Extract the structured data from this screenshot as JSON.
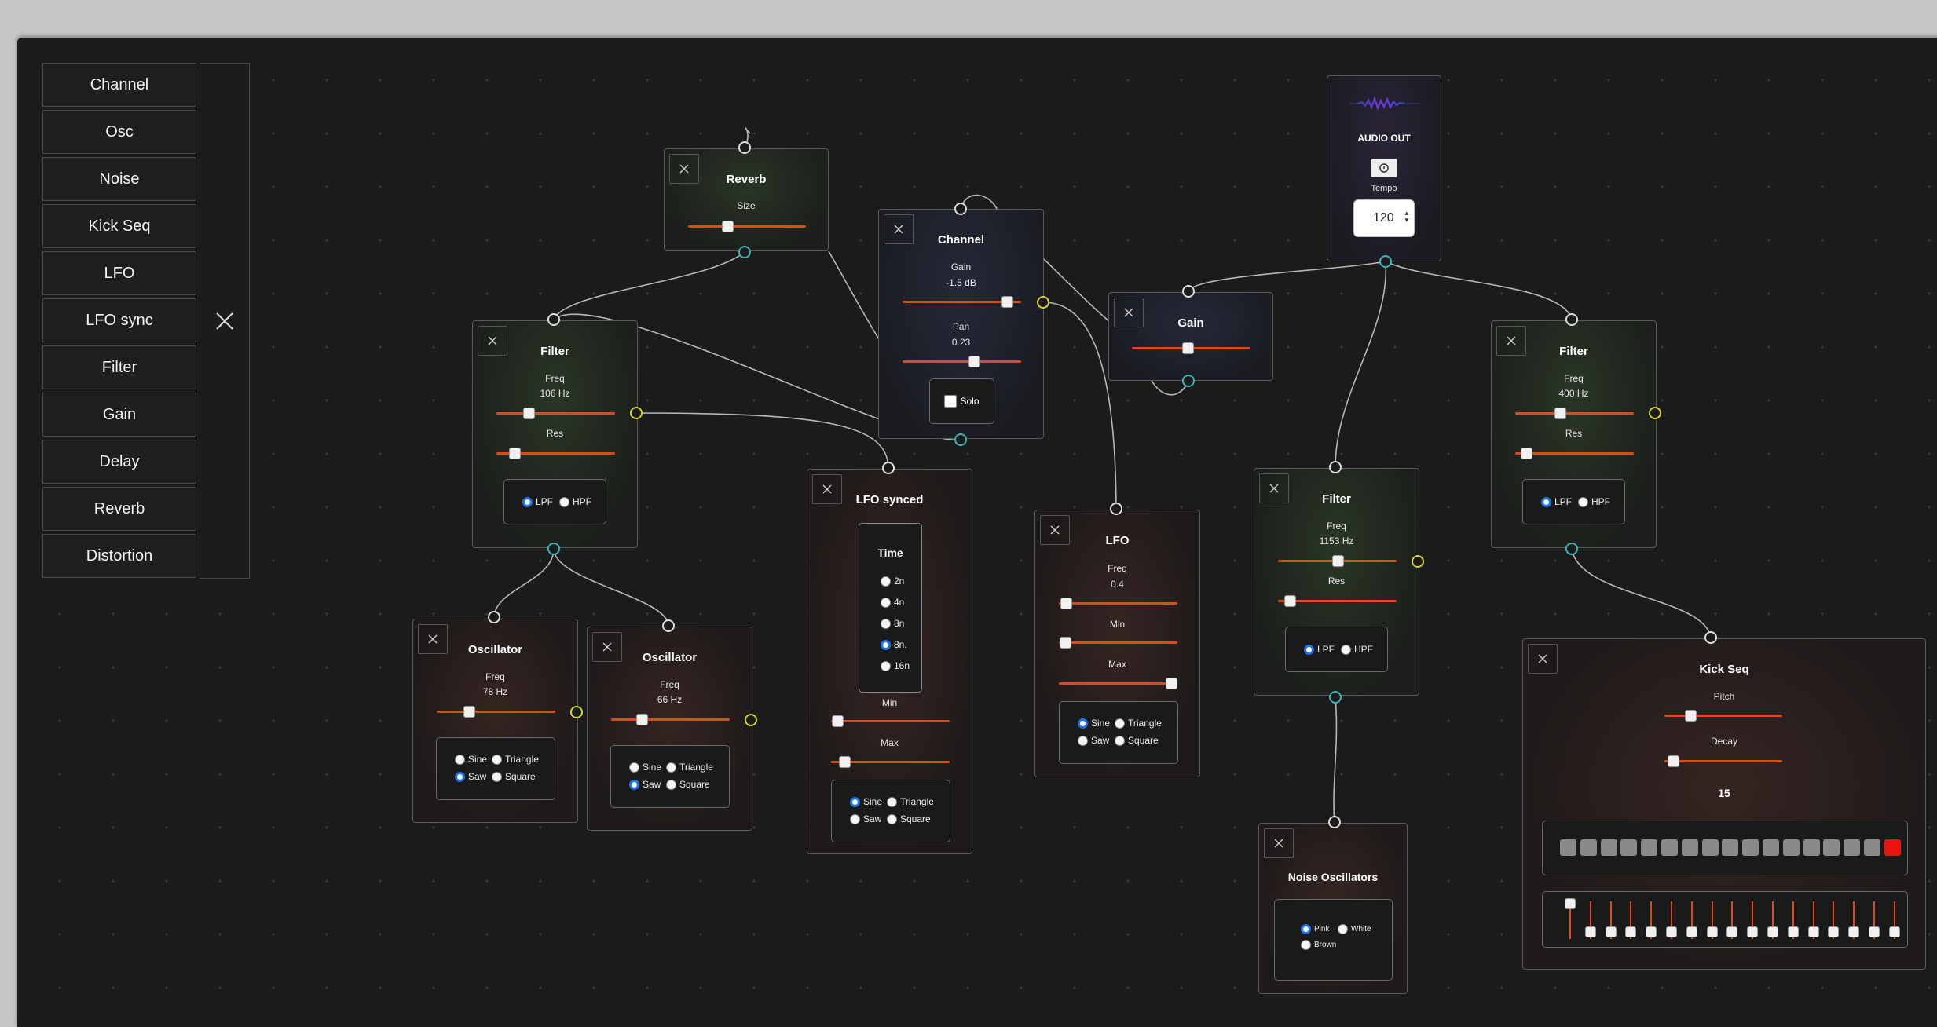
{
  "sidebar": {
    "items": [
      "Channel",
      "Osc",
      "Noise",
      "Kick Seq",
      "LFO",
      "LFO sync",
      "Filter",
      "Gain",
      "Delay",
      "Reverb",
      "Distortion"
    ]
  },
  "colors": {
    "background": "#1b1b1b",
    "slider_track": "#e04a1a",
    "port_input": "#dddddd",
    "port_modulation": "#3ab3b8",
    "port_output": "#d5d52a",
    "radio_selected": "#1a73e8",
    "step_active": "#ee1111",
    "step_inactive": "#8a8a8a"
  },
  "icons": {
    "close": "close-icon",
    "power": "power-icon",
    "waveform": "waveform-icon"
  },
  "nodes": {
    "reverb": {
      "title": "Reverb",
      "size_label": "Size",
      "size_value": 0.33
    },
    "channel": {
      "title": "Channel",
      "gain_label": "Gain",
      "gain_text": "-1.5 dB",
      "gain_value": 0.88,
      "pan_label": "Pan",
      "pan_text": "0.23",
      "pan_value": 0.6,
      "solo_label": "Solo",
      "solo_checked": false
    },
    "audio_out": {
      "title": "AUDIO OUT",
      "tempo_label": "Tempo",
      "tempo_value": "120"
    },
    "gain": {
      "title": "Gain",
      "value": 0.47
    },
    "filter1": {
      "title": "Filter",
      "freq_label": "Freq",
      "freq_text": "106 Hz",
      "freq_value": 0.27,
      "res_label": "Res",
      "res_value": 0.15,
      "lpf_label": "LPF",
      "hpf_label": "HPF",
      "selected": "LPF"
    },
    "filter2": {
      "title": "Filter",
      "freq_label": "Freq",
      "freq_text": "1153 Hz",
      "freq_value": 0.5,
      "res_label": "Res",
      "res_value": 0.1,
      "lpf_label": "LPF",
      "hpf_label": "HPF",
      "selected": "LPF"
    },
    "filter3": {
      "title": "Filter",
      "freq_label": "Freq",
      "freq_text": "400 Hz",
      "freq_value": 0.38,
      "res_label": "Res",
      "res_value": 0.09,
      "lpf_label": "LPF",
      "hpf_label": "HPF",
      "selected": "LPF"
    },
    "lfo_synced": {
      "title": "LFO synced",
      "time_label": "Time",
      "time_options": [
        "2n",
        "4n",
        "8n",
        "8n.",
        "16n"
      ],
      "time_selected": "8n.",
      "min_label": "Min",
      "min_value": 0.05,
      "max_label": "Max",
      "max_value": 0.11,
      "waves": [
        "Sine",
        "Triangle",
        "Saw",
        "Square"
      ],
      "wave_selected": "Sine"
    },
    "lfo": {
      "title": "LFO",
      "freq_label": "Freq",
      "freq_text": "0.4",
      "freq_value": 0.06,
      "min_label": "Min",
      "min_value": 0.05,
      "max_label": "Max",
      "max_value": 0.95,
      "waves": [
        "Sine",
        "Triangle",
        "Saw",
        "Square"
      ],
      "wave_selected": "Sine"
    },
    "osc1": {
      "title": "Oscillator",
      "freq_label": "Freq",
      "freq_text": "78 Hz",
      "freq_value": 0.27,
      "waves": [
        "Sine",
        "Triangle",
        "Saw",
        "Square"
      ],
      "wave_selected": "Saw"
    },
    "osc2": {
      "title": "Oscillator",
      "freq_label": "Freq",
      "freq_text": "66 Hz",
      "freq_value": 0.26,
      "waves": [
        "Sine",
        "Triangle",
        "Saw",
        "Square"
      ],
      "wave_selected": "Saw"
    },
    "noise": {
      "title": "Noise Oscillators",
      "types": [
        "Pink",
        "White",
        "Brown"
      ],
      "selected": "Pink"
    },
    "kick_seq": {
      "title": "Kick Seq",
      "pitch_label": "Pitch",
      "pitch_value": 0.22,
      "decay_label": "Decay",
      "decay_value": 0.07,
      "step_count": "15",
      "steps": [
        0,
        0,
        0,
        0,
        0,
        0,
        0,
        0,
        0,
        0,
        0,
        0,
        0,
        0,
        0,
        0,
        1
      ],
      "velocities": [
        1,
        0,
        0,
        0,
        0,
        0,
        0,
        0,
        0,
        0,
        0,
        0,
        0,
        0,
        0,
        0,
        0
      ]
    }
  }
}
